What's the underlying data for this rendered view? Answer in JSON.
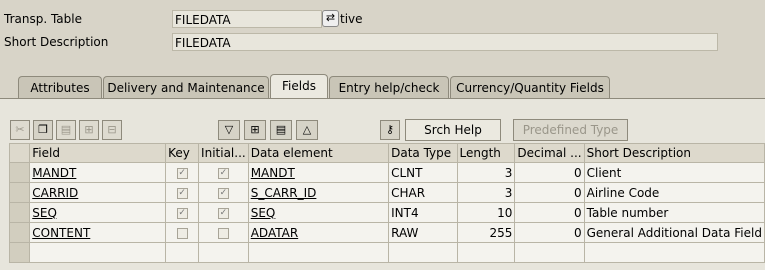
{
  "header": {
    "transp_table_label": "Transp. Table",
    "transp_table_value": "FILEDATA",
    "status_text": "tive",
    "status_icon": "display-change-icon",
    "short_desc_label": "Short Description",
    "short_desc_value": "FILEDATA"
  },
  "tabs": [
    {
      "label": "Attributes"
    },
    {
      "label": "Delivery and Maintenance"
    },
    {
      "label": "Fields",
      "active": true
    },
    {
      "label": "Entry help/check"
    },
    {
      "label": "Currency/Quantity Fields"
    }
  ],
  "toolbar": {
    "icons": [
      "cut-icon",
      "copy-icon",
      "paste-icon",
      "insert-row-icon",
      "delete-row-icon",
      "filter-icon",
      "new-rows-icon",
      "select-block-icon",
      "sort-icon",
      "key-icon"
    ],
    "srch_help_label": "Srch Help",
    "predefined_type_label": "Predefined Type"
  },
  "table": {
    "columns": [
      "Field",
      "Key",
      "Initial...",
      "Data element",
      "Data Type",
      "Length",
      "Decimal ...",
      "Short Description"
    ],
    "rows": [
      {
        "field": "MANDT",
        "key": true,
        "initial": true,
        "data_element": "MANDT",
        "data_type": "CLNT",
        "length": "3",
        "decimal": "0",
        "short_desc": "Client"
      },
      {
        "field": "CARRID",
        "key": true,
        "initial": true,
        "data_element": "S_CARR_ID",
        "data_type": "CHAR",
        "length": "3",
        "decimal": "0",
        "short_desc": "Airline Code"
      },
      {
        "field": "SEQ",
        "key": true,
        "initial": true,
        "data_element": "SEQ",
        "data_type": "INT4",
        "length": "10",
        "decimal": "0",
        "short_desc": "Table number"
      },
      {
        "field": "CONTENT",
        "key": false,
        "initial": false,
        "data_element": "ADATAR",
        "data_type": "RAW",
        "length": "255",
        "decimal": "0",
        "short_desc": "General Additional Data Field"
      }
    ]
  }
}
